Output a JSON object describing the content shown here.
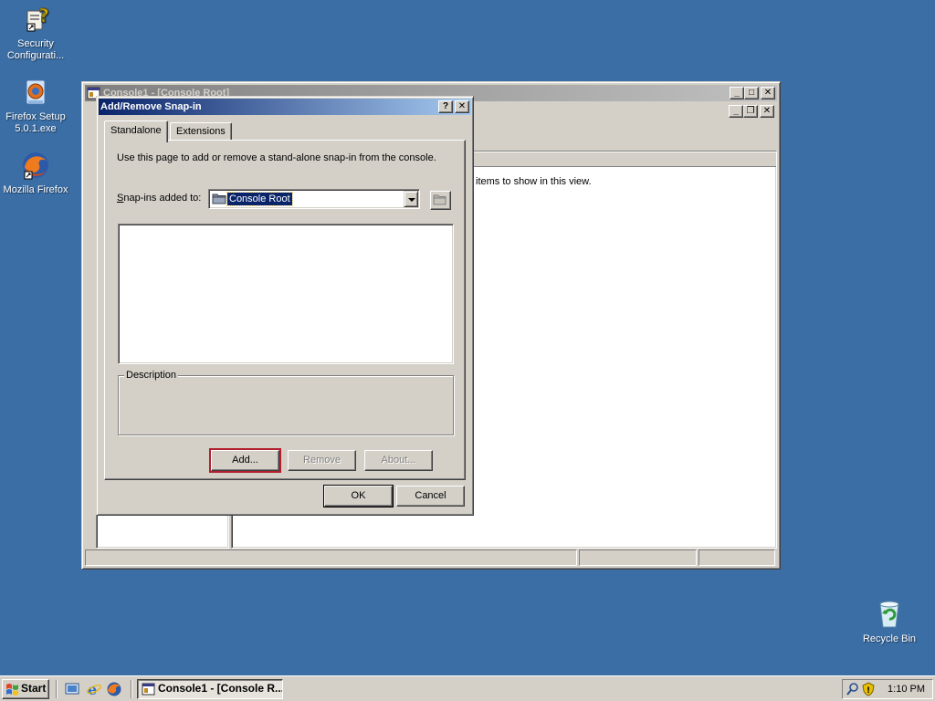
{
  "desktop": {
    "icons": [
      {
        "label": "Security\nConfigurati...",
        "icon": "security-config-icon"
      },
      {
        "label": "Firefox Setup\n5.0.1.exe",
        "icon": "firefox-setup-icon"
      },
      {
        "label": "Mozilla Firefox",
        "icon": "firefox-icon"
      },
      {
        "label": "Recycle Bin",
        "icon": "recycle-bin-icon"
      }
    ]
  },
  "mmc": {
    "title": "Console1 - [Console Root]",
    "result_empty_text": "items to show in this view."
  },
  "dialog": {
    "title": "Add/Remove Snap-in",
    "help_glyph": "?",
    "close_glyph": "✕",
    "tabs": [
      {
        "label": "Standalone",
        "active": true
      },
      {
        "label": "Extensions",
        "active": false
      }
    ],
    "instruction": "Use this page to add or remove a stand-alone snap-in from the console.",
    "snapins_label_prefix": "S",
    "snapins_label_rest": "nap-ins added to:",
    "combo_value": "Console Root",
    "description_label": "Description",
    "buttons": {
      "add": "Add...",
      "remove": "Remove",
      "about": "About...",
      "ok": "OK",
      "cancel": "Cancel"
    }
  },
  "taskbar": {
    "start_label": "Start",
    "task_label": "Console1 - [Console R...",
    "clock": "1:10 PM"
  },
  "colors": {
    "desktop": "#3a6ea5",
    "titlebar_active": "#0a246a",
    "titlebar_inactive": "#808080",
    "highlight_outline": "#b21f2d"
  }
}
